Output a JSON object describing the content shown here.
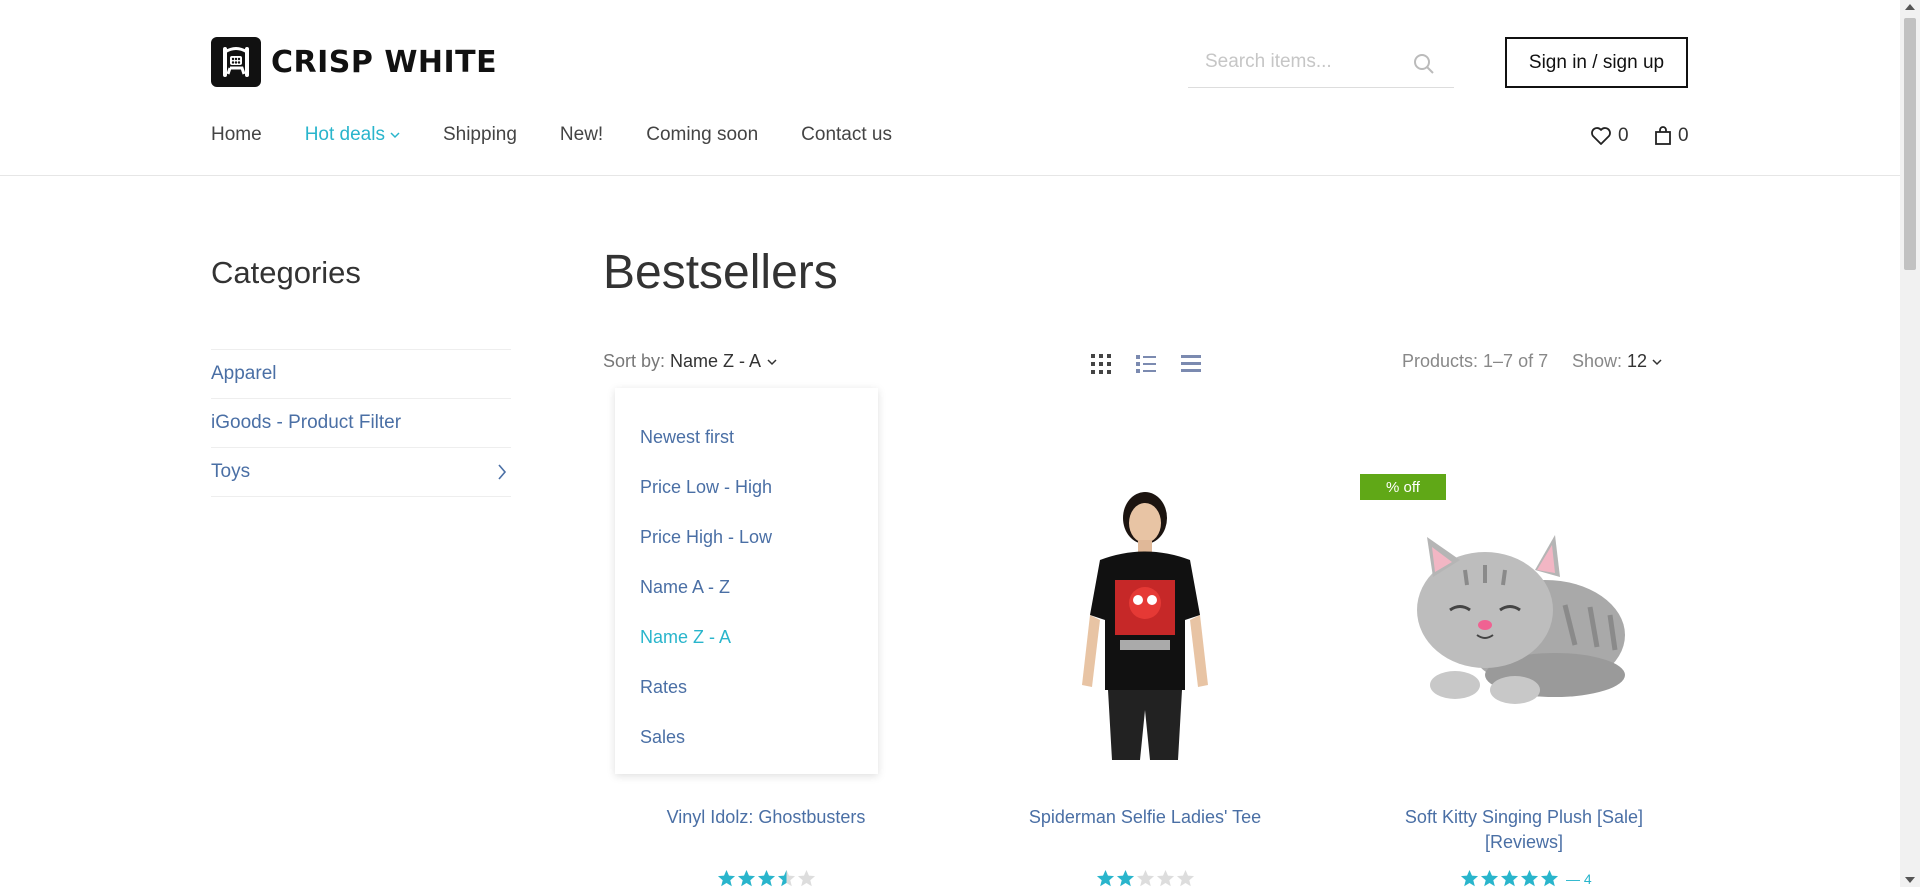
{
  "brand": {
    "name": "CRISP WHITE",
    "logo_icon": "robot-logo-icon"
  },
  "search": {
    "placeholder": "Search items..."
  },
  "auth": {
    "signin_label": "Sign in / sign up"
  },
  "nav": {
    "items": [
      {
        "label": "Home",
        "active": false
      },
      {
        "label": "Hot deals",
        "active": true,
        "has_dropdown": true
      },
      {
        "label": "Shipping",
        "active": false
      },
      {
        "label": "New!",
        "active": false
      },
      {
        "label": "Coming soon",
        "active": false
      },
      {
        "label": "Contact us",
        "active": false
      }
    ]
  },
  "header_counts": {
    "wishlist": "0",
    "cart": "0"
  },
  "sidebar": {
    "title": "Categories",
    "items": [
      {
        "label": "Apparel"
      },
      {
        "label": "iGoods - Product Filter"
      },
      {
        "label": "Toys",
        "has_children": true
      }
    ]
  },
  "main": {
    "title": "Bestsellers",
    "sort_label": "Sort by:",
    "sort_value": "Name Z - A",
    "products_count": "Products: 1–7 of 7",
    "show_label": "Show:",
    "show_value": "12"
  },
  "sort_dropdown": {
    "options": [
      {
        "label": "Newest first",
        "selected": false
      },
      {
        "label": "Price Low - High",
        "selected": false
      },
      {
        "label": "Price High - Low",
        "selected": false
      },
      {
        "label": "Name A - Z",
        "selected": false
      },
      {
        "label": "Name Z - A",
        "selected": true
      },
      {
        "label": "Rates",
        "selected": false
      },
      {
        "label": "Sales",
        "selected": false
      }
    ]
  },
  "products": [
    {
      "title": "Vinyl Idolz: Ghostbusters",
      "rating": 3.5,
      "badge": ""
    },
    {
      "title": "Spiderman Selfie Ladies' Tee",
      "rating": 2,
      "badge": ""
    },
    {
      "title_line1": "Soft Kitty Singing Plush [Sale]",
      "title_line2": "[Reviews]",
      "rating": 5,
      "reviews": "— 4",
      "badge": "% off"
    }
  ],
  "colors": {
    "accent": "#29b5cc",
    "link": "#4a6fa5",
    "badge_green": "#60a817",
    "star": "#29b5cc"
  }
}
